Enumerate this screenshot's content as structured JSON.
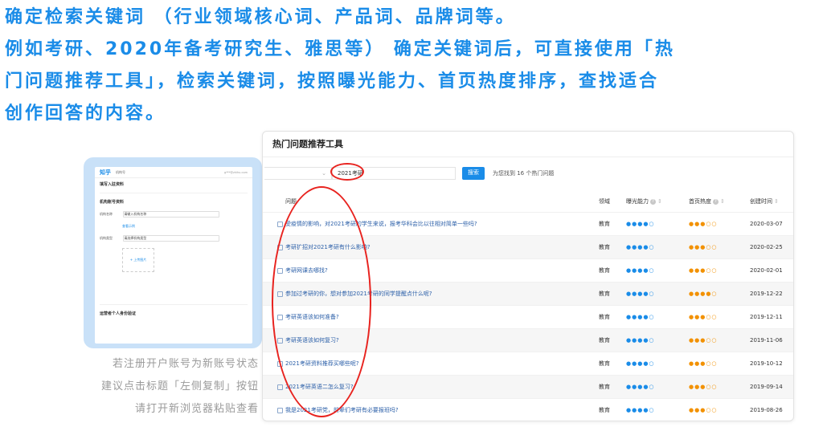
{
  "intro": [
    "确定检索关键词 （行业领域核心词、产品词、品牌词等。",
    "例如考研、2020年备考研究生、雅思等） 确定关键词后，可直接使用「热",
    "门问题推荐工具」，检索关键词，按照曝光能力、首页热度排序，查找适合",
    "创作回答的内容。"
  ],
  "preview": {
    "logo": "知乎",
    "nav": "机构号",
    "user": "g***@zhihu.com",
    "title": "填写入驻资料",
    "section": "机构账号资料",
    "field_name": "机构名称",
    "field_name_hint": "请输入机构名称",
    "field_type": "机构类型",
    "field_type_hint": "请选择机构类型",
    "upload_label": "+ 上传图片",
    "link": "查看示例",
    "footer": "运营者个人身份验证"
  },
  "tips": [
    "若注册开户账号为新账号状态",
    "建议点击标题「左侧复制」按钮",
    "请打开新浏览器粘贴查看"
  ],
  "tool": {
    "title": "热门问题推荐工具",
    "keyword": "2021考研",
    "search_button": "搜索",
    "result_text": "为您找到 16 个热门问题",
    "columns": {
      "question": "问题",
      "domain": "领域",
      "exposure": "曝光能力",
      "heat": "首页热度",
      "created": "创建时间"
    },
    "rows": [
      {
        "q": "受疫情的影响，对2021考研的学生来说，报考华科会比以往相对简单一些吗?",
        "domain": "教育",
        "exposure": "●●●●○",
        "heat": "●●●○○",
        "date": "2020-03-07"
      },
      {
        "q": "考研扩招对2021考研有什么影响?",
        "domain": "教育",
        "exposure": "●●●●○",
        "heat": "●●●○○",
        "date": "2020-02-25"
      },
      {
        "q": "考研网课去哪找?",
        "domain": "教育",
        "exposure": "●●●●○",
        "heat": "●●●○○",
        "date": "2020-02-01"
      },
      {
        "q": "参加过考研的你，想对参加2021考研的同学提醒点什么呢?",
        "domain": "教育",
        "exposure": "●●●●○",
        "heat": "●●●●○",
        "date": "2019-12-22"
      },
      {
        "q": "考研英语该如何准备?",
        "domain": "教育",
        "exposure": "●●●●○",
        "heat": "●●●○○",
        "date": "2019-12-11"
      },
      {
        "q": "考研英语该如何复习?",
        "domain": "教育",
        "exposure": "●●●●○",
        "heat": "●●●○○",
        "date": "2019-11-06"
      },
      {
        "q": "2021考研资料推荐买哪些呢?",
        "domain": "教育",
        "exposure": "●●●●○",
        "heat": "●●●○○",
        "date": "2019-10-12"
      },
      {
        "q": "2021考研英语二怎么复习?",
        "domain": "教育",
        "exposure": "●●●●○",
        "heat": "●●●○○",
        "date": "2019-09-14"
      },
      {
        "q": "我是2021考研党，前辈们考研有必要报班吗?",
        "domain": "教育",
        "exposure": "●●●●○",
        "heat": "●●●○○",
        "date": "2019-08-26"
      }
    ]
  },
  "colors": {
    "accent": "#1a8ce8",
    "heat": "#f29100",
    "annotation": "#e8231f"
  }
}
